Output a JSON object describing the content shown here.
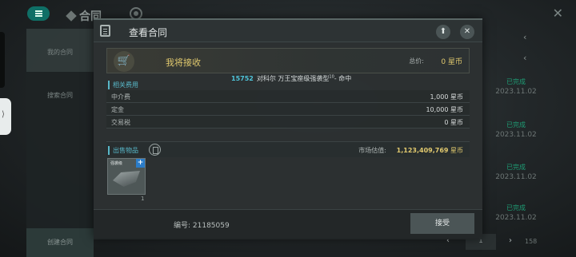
{
  "background": {
    "app_title": "合同",
    "nav": {
      "my_contracts": "我的合同",
      "search_contracts": "搜索合同"
    },
    "create_contract": "创建合同",
    "rows": [
      {
        "status": "已完成",
        "date": "2023.11.02"
      },
      {
        "status": "已完成",
        "date": "2023.11.02"
      },
      {
        "status": "已完成",
        "date": "2023.11.02"
      },
      {
        "status": "已完成",
        "date": "2023.11.02"
      }
    ],
    "pagination": {
      "current_page": "1",
      "total": "158"
    }
  },
  "modal": {
    "title": "查看合同",
    "receive": {
      "label": "我将接收",
      "total_label": "总价:",
      "total_value": "0 星币"
    },
    "ship": {
      "id": "15752",
      "name": "对科尔 万王宝座级强袭型",
      "sup": "10",
      "suffix": "- 命中"
    },
    "fees_section_label": "相关费用",
    "fees": [
      {
        "name": "中介费",
        "value": "1,000 星币"
      },
      {
        "name": "定金",
        "value": "10,000 星币"
      },
      {
        "name": "交易税",
        "value": "0 星币"
      }
    ],
    "sale": {
      "section_label": "出售物品",
      "market_label": "市场估值:",
      "market_value": "1,123,409,769",
      "market_unit": "星币"
    },
    "item": {
      "name": "强袭级",
      "count": "1"
    },
    "contract_number": "编号: 21185059",
    "accept_label": "接受"
  }
}
